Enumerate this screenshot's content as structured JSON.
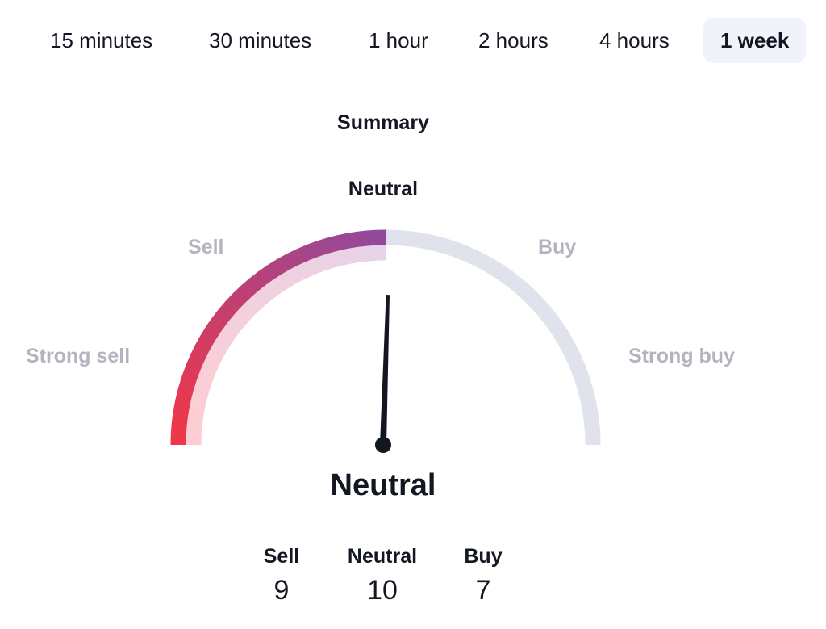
{
  "tabs": [
    {
      "label": "15 minutes",
      "active": false
    },
    {
      "label": "30 minutes",
      "active": false
    },
    {
      "label": "1 hour",
      "active": false
    },
    {
      "label": "2 hours",
      "active": false
    },
    {
      "label": "4 hours",
      "active": false
    },
    {
      "label": "1 week",
      "active": true
    }
  ],
  "summary": {
    "title": "Summary",
    "rating": "Neutral",
    "verdict": "Neutral"
  },
  "gauge": {
    "labels": {
      "strong_sell": "Strong sell",
      "sell": "Sell",
      "buy": "Buy",
      "strong_buy": "Strong buy"
    },
    "filled_fraction": 0.5,
    "needle_fraction": 0.51,
    "colors": {
      "fill_start": "#f23645",
      "fill_end": "#8e4a9e",
      "track": "#e0e3eb",
      "needle": "#131722"
    }
  },
  "counts": [
    {
      "label": "Sell",
      "value": "9"
    },
    {
      "label": "Neutral",
      "value": "10"
    },
    {
      "label": "Buy",
      "value": "7"
    }
  ]
}
